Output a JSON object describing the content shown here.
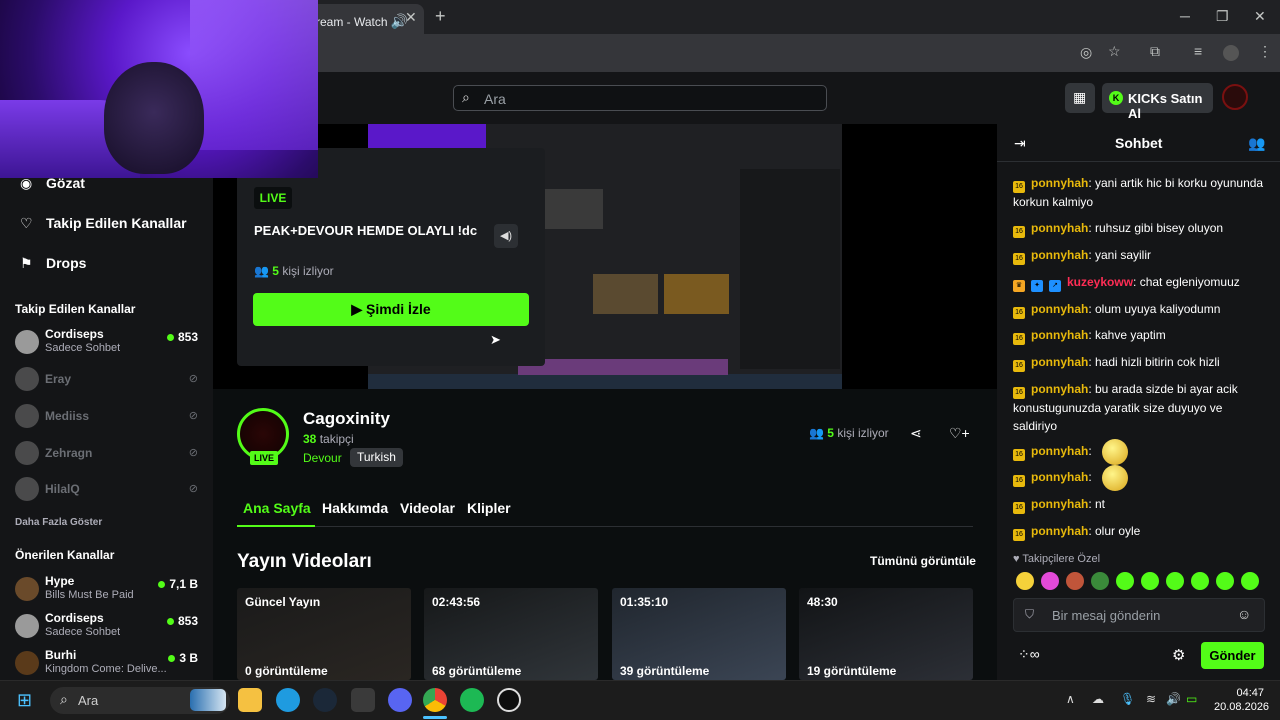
{
  "browser": {
    "tab_title": "ream - Watch",
    "new_tab": "+"
  },
  "header": {
    "search_placeholder": "Ara",
    "kicks_button": "KICKs Satın Al"
  },
  "sidebar": {
    "nav": [
      {
        "label": "Gözat",
        "icon": "compass-icon"
      },
      {
        "label": "Takip Edilen Kanallar",
        "icon": "heart-icon"
      },
      {
        "label": "Drops",
        "icon": "drops-icon"
      }
    ],
    "followed_header": "Takip Edilen Kanallar",
    "followed": [
      {
        "name": "Cordiseps",
        "sub": "Sadece Sohbet",
        "count": "853",
        "live": true
      },
      {
        "name": "Eray",
        "live": false
      },
      {
        "name": "Mediiss",
        "live": false
      },
      {
        "name": "Zehragn",
        "live": false
      },
      {
        "name": "HilalQ",
        "live": false
      }
    ],
    "show_more": "Daha Fazla Göster",
    "recommended_header": "Önerilen Kanallar",
    "recommended": [
      {
        "name": "Hype",
        "sub": "Bills Must Be Paid",
        "count": "7,1 B"
      },
      {
        "name": "Cordiseps",
        "sub": "Sadece Sohbet",
        "count": "853"
      },
      {
        "name": "Burhi",
        "sub": "Kingdom Come: Delive...",
        "count": "3 B"
      }
    ]
  },
  "popup": {
    "live": "LIVE",
    "title": "PEAK+DEVOUR HEMDE OLAYLI !dc",
    "viewers_count": "5",
    "viewers_label": "kişi izliyor",
    "watch_button": "Şimdi İzle"
  },
  "channel": {
    "name": "Cagoxinity",
    "followers_count": "38",
    "followers_label": "takipçi",
    "category": "Devour",
    "language": "Turkish",
    "live": "LIVE",
    "viewers_count": "5",
    "viewers_label": "kişi izliyor",
    "tabs": [
      "Ana Sayfa",
      "Hakkımda",
      "Videolar",
      "Klipler"
    ]
  },
  "videos": {
    "title": "Yayın Videoları",
    "see_all": "Tümünü görüntüle",
    "items": [
      {
        "duration": "Güncel Yayın",
        "views": "0 görüntüleme"
      },
      {
        "duration": "02:43:56",
        "views": "68 görüntüleme"
      },
      {
        "duration": "01:35:10",
        "views": "39 görüntüleme"
      },
      {
        "duration": "48:30",
        "views": "19 görüntüleme"
      }
    ]
  },
  "chat": {
    "title": "Sohbet",
    "messages": [
      {
        "user": "ponnyhah",
        "text": ": yani artik hic bi korku oyununda korkun kalmiyo"
      },
      {
        "user": "ponnyhah",
        "text": ": ruhsuz gibi bisey oluyon"
      },
      {
        "user": "ponnyhah",
        "text": ": yani sayilir"
      },
      {
        "user": "kuzeykoww",
        "text": ": chat egleniyomuuz"
      },
      {
        "user": "ponnyhah",
        "text": ": olum uyuya kaliyodumn"
      },
      {
        "user": "ponnyhah",
        "text": ": kahve yaptim"
      },
      {
        "user": "ponnyhah",
        "text": ": hadi hizli bitirin cok hizli"
      },
      {
        "user": "ponnyhah",
        "text": ": bu arada sizde bi ayar acik konustugunuzda yaratik size duyuyo ve saldiriyo"
      },
      {
        "user": "ponnyhah",
        "text": ":"
      },
      {
        "user": "ponnyhah",
        "text": ":"
      },
      {
        "user": "ponnyhah",
        "text": ": nt"
      },
      {
        "user": "ponnyhah",
        "text": ": olur oyle"
      }
    ],
    "followers_only": "Takipçilere Özel",
    "input_placeholder": "Bir mesaj gönderin",
    "send": "Gönder"
  },
  "taskbar": {
    "search": "Ara",
    "time": "04:47",
    "date": "20.08.2026"
  },
  "colors": {
    "accent": "#53fc18",
    "badge": "#e8b90c"
  }
}
